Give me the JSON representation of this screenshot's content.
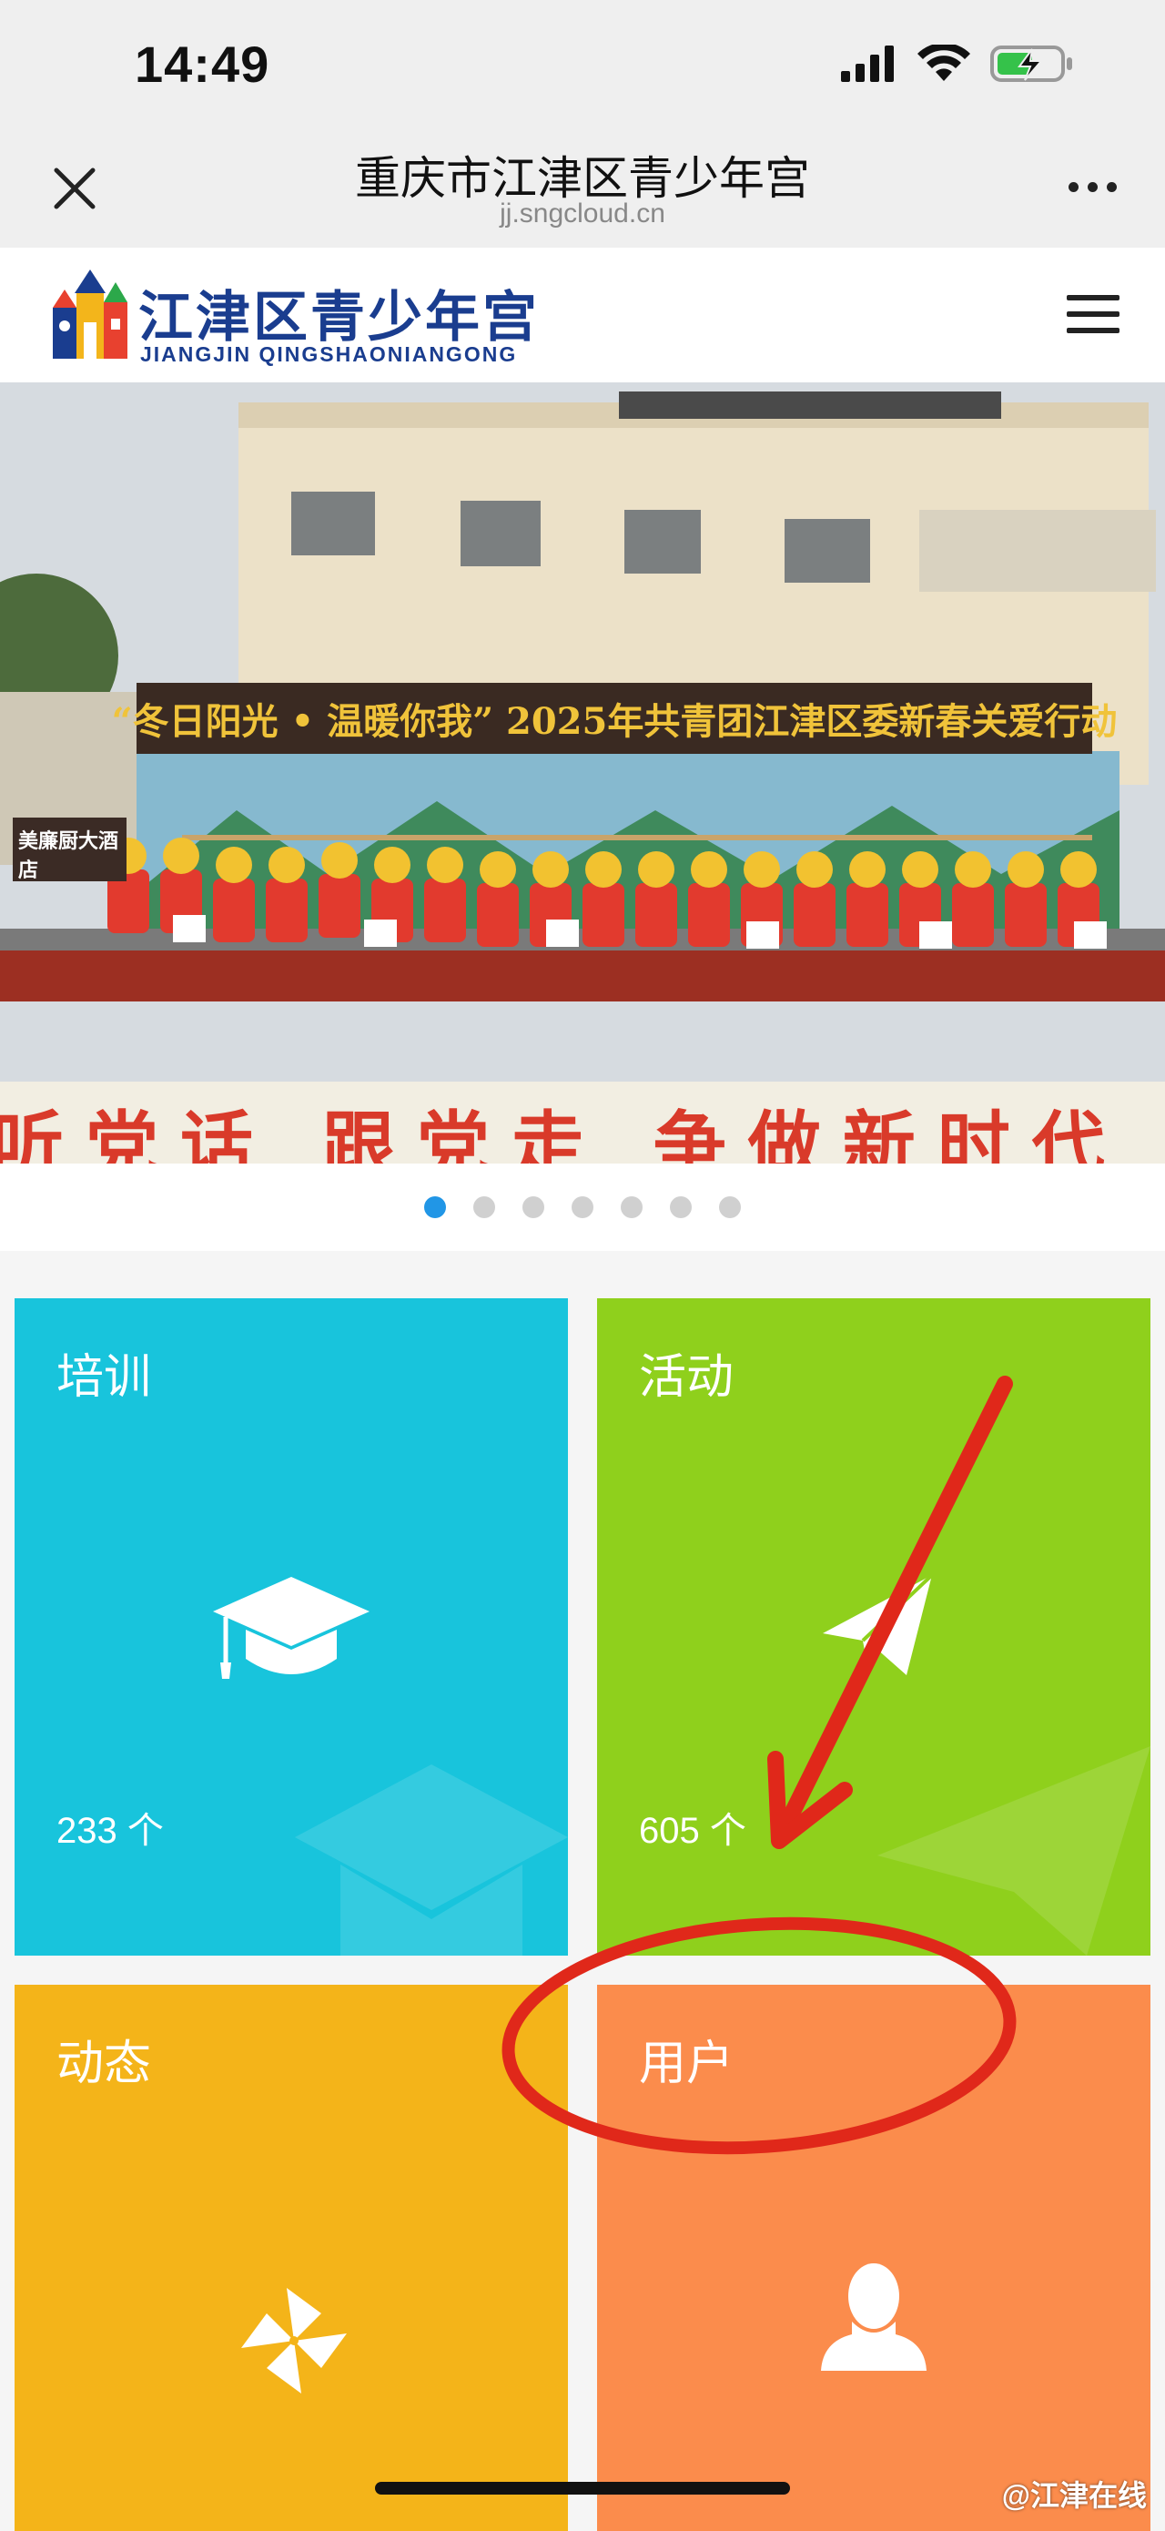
{
  "status_bar": {
    "time": "14:49"
  },
  "browser": {
    "title": "重庆市江津区青少年宫",
    "url": "jj.sngcloud.cn"
  },
  "site": {
    "logo_text": "江津区青少年宫",
    "logo_subtext": "JIANGJIN QINGSHAONIANGONG"
  },
  "banner": {
    "headline": "“冬日阳光 • 温暖你我” 2025年共青团江津区委新春关爱行动",
    "slogan": "听党话 跟党走 争做新时代",
    "hotel_sign": "美廉厨大酒店",
    "slide_count": 7,
    "active_slide": 1
  },
  "tiles": [
    {
      "label": "培训",
      "count": "233 个",
      "color": "#18c4dc",
      "icon": "graduation-cap-icon"
    },
    {
      "label": "活动",
      "count": "605 个",
      "color": "#8fd01c",
      "icon": "paper-plane-icon"
    },
    {
      "label": "动态",
      "count": "",
      "color": "#f4b419",
      "icon": "pinwheel-icon"
    },
    {
      "label": "用户",
      "count": "",
      "color": "#fb8c4c",
      "icon": "user-icon"
    }
  ],
  "annotation": {
    "color": "#e0281a"
  },
  "watermark": "@江津在线"
}
